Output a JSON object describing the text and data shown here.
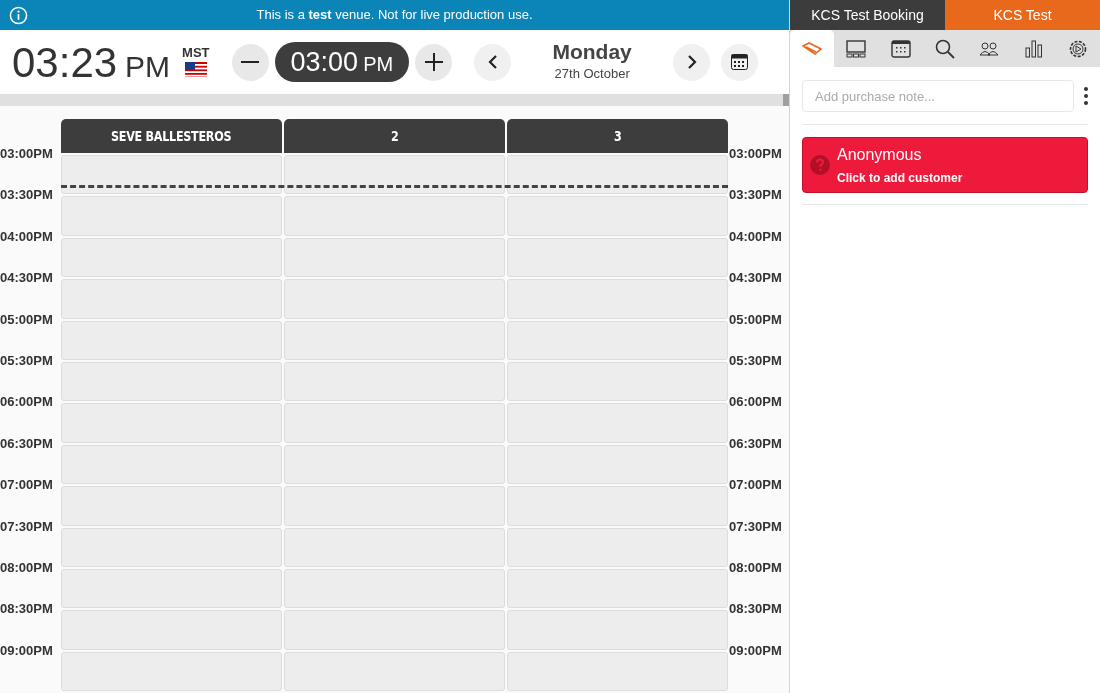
{
  "banner": {
    "text": "This is a **test** venue. Not for live production use."
  },
  "clock": {
    "time": "03:23",
    "ampm": "PM",
    "timezone": "MST"
  },
  "time_picker": {
    "time": "03:00",
    "ampm": "PM"
  },
  "date": {
    "day": "Monday",
    "date": "27th October"
  },
  "columns": [
    "SEVE BALLESTEROS",
    "2",
    "3"
  ],
  "rows": [
    {
      "time_left": "03:00PM",
      "time_right": "03:00PM"
    },
    {
      "time_left": "03:30PM",
      "time_right": "03:30PM"
    },
    {
      "time_left": "04:00PM",
      "time_right": "04:00PM"
    },
    {
      "time_left": "04:30PM",
      "time_right": "04:30PM"
    },
    {
      "time_left": "05:00PM",
      "time_right": "05:00PM"
    },
    {
      "time_left": "05:30PM",
      "time_right": "05:30PM"
    },
    {
      "time_left": "06:00PM",
      "time_right": "06:00PM"
    },
    {
      "time_left": "06:30PM",
      "time_right": "06:30PM"
    },
    {
      "time_left": "07:00PM",
      "time_right": "07:00PM"
    },
    {
      "time_left": "07:30PM",
      "time_right": "07:30PM"
    },
    {
      "time_left": "08:00PM",
      "time_right": "08:00PM"
    },
    {
      "time_left": "08:30PM",
      "time_right": "08:30PM"
    },
    {
      "time_left": "09:00PM",
      "time_right": "09:00PM"
    }
  ],
  "venue_tabs": [
    {
      "label": "KCS Test Booking",
      "selected": false
    },
    {
      "label": "KCS Test",
      "selected": true
    }
  ],
  "tool_tabs": [
    {
      "selected": true
    },
    {
      "selected": false
    },
    {
      "selected": false
    },
    {
      "selected": false
    },
    {
      "selected": false
    },
    {
      "selected": false
    },
    {
      "selected": false
    }
  ],
  "purchase_note": {
    "placeholder": "Add purchase note..."
  },
  "customer": {
    "name": "Anonymous",
    "hint": "Click to add customer"
  }
}
